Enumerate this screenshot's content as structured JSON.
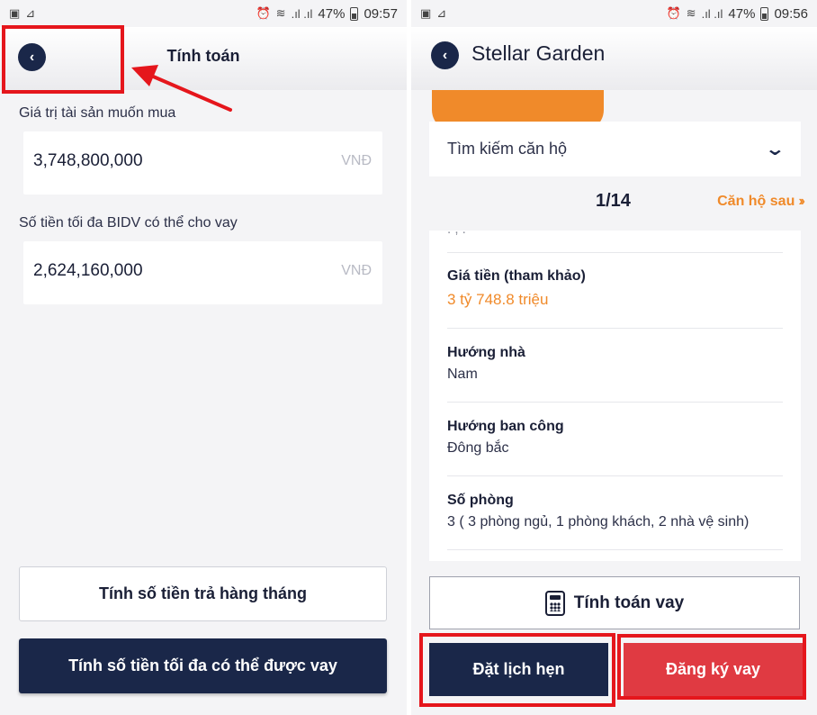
{
  "left": {
    "status_bar": {
      "battery": "47%",
      "time": "09:57"
    },
    "header": {
      "title": "Tính toán",
      "back_icon": "chevron-left-icon"
    },
    "fields": [
      {
        "label": "Giá trị tài sản muốn mua",
        "value": "3,748,800,000",
        "unit": "VNĐ"
      },
      {
        "label": "Số tiền tối đa BIDV có thể cho vay",
        "value": "2,624,160,000",
        "unit": "VNĐ"
      }
    ],
    "buttons": {
      "monthly": "Tính số tiền trả hàng tháng",
      "max_loan": "Tính số tiền tối đa có thể được vay"
    }
  },
  "right": {
    "status_bar": {
      "battery": "47%",
      "time": "09:56"
    },
    "header": {
      "title": "Stellar Garden",
      "back_icon": "chevron-left-icon"
    },
    "search": {
      "label": "Tìm kiếm căn hộ"
    },
    "pager": {
      "text": "1/14",
      "next_label": "Căn hộ sau"
    },
    "details": [
      {
        "label": "Giá tiền (tham khảo)",
        "value": "3 tỷ 748.8 triệu",
        "highlight": true
      },
      {
        "label": "Hướng nhà",
        "value": "Nam"
      },
      {
        "label": "Hướng ban công",
        "value": "Đông bắc"
      },
      {
        "label": "Số phòng",
        "value": "3 ( 3 phòng ngủ, 1 phòng khách, 2 nhà vệ sinh)"
      }
    ],
    "buttons": {
      "calc": "Tính toán vay",
      "book": "Đặt lịch hẹn",
      "register": "Đăng ký vay"
    }
  },
  "colors": {
    "navy": "#1a2749",
    "orange": "#f08a2a",
    "red_button": "#e03a42",
    "annotation_red": "#e5161c"
  }
}
